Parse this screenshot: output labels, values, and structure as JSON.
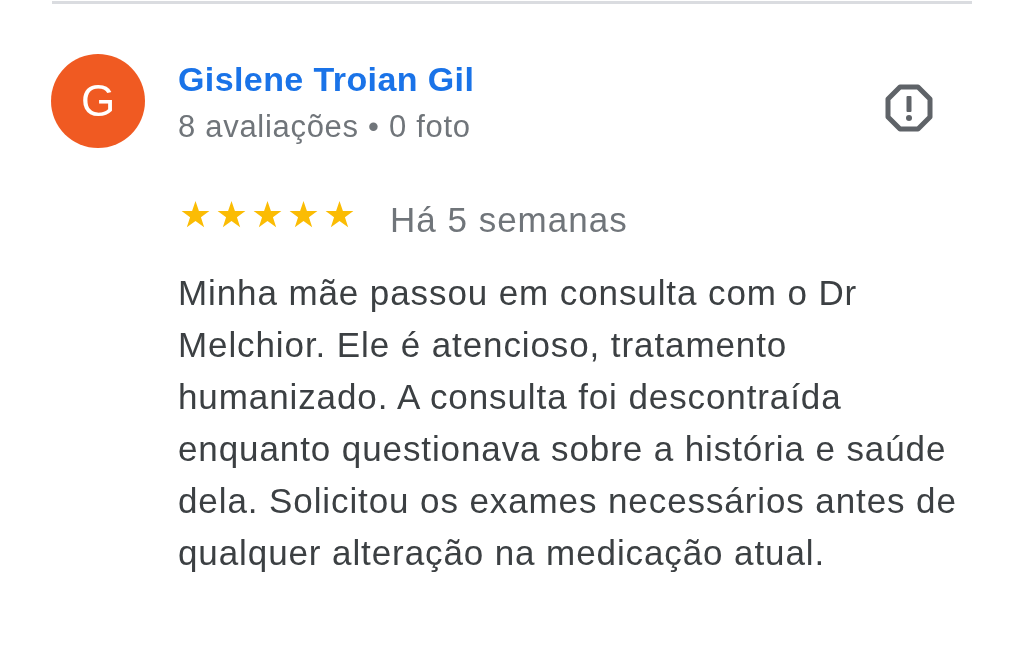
{
  "review": {
    "author": {
      "initial": "G",
      "name": "Gislene Troian Gil",
      "stats": "8 avaliações • 0 foto"
    },
    "stars": 5,
    "time": "Há 5 semanas",
    "text": "Minha mãe passou em consulta com o Dr Melchior. Ele é atencioso, tratamento humanizado. A consulta foi descontraída enquanto questionava sobre a história e saúde dela. Solicitou os exames necessários antes de qualquer alteração na medicação atual."
  }
}
